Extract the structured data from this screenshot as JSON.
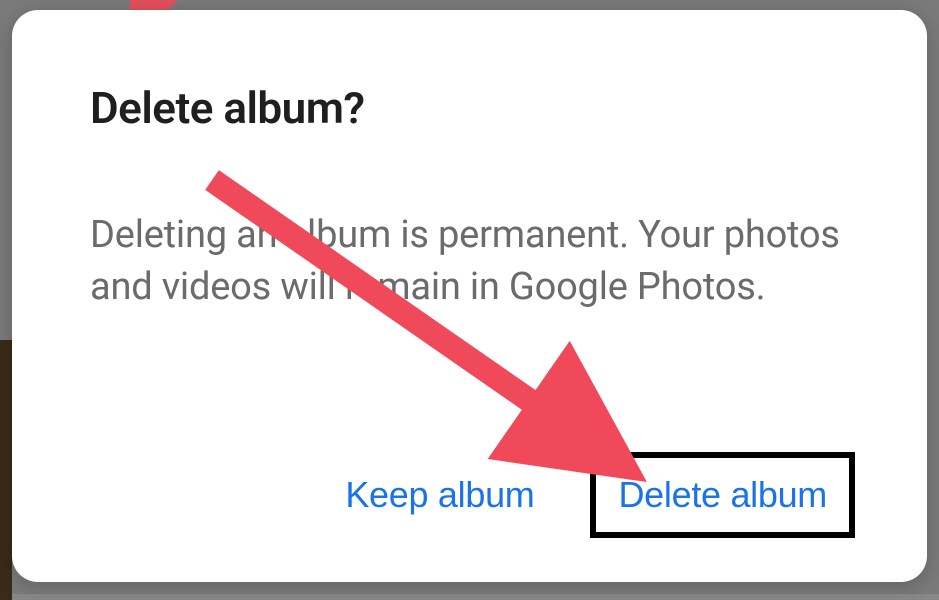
{
  "dialog": {
    "title": "Delete album?",
    "body": "Deleting an album is permanent. Your photos and videos will remain in Google Photos.",
    "keep_label": "Keep album",
    "delete_label": "Delete album"
  },
  "colors": {
    "accent": "#1a73e8",
    "annotation_arrow": "#f04a5a"
  }
}
